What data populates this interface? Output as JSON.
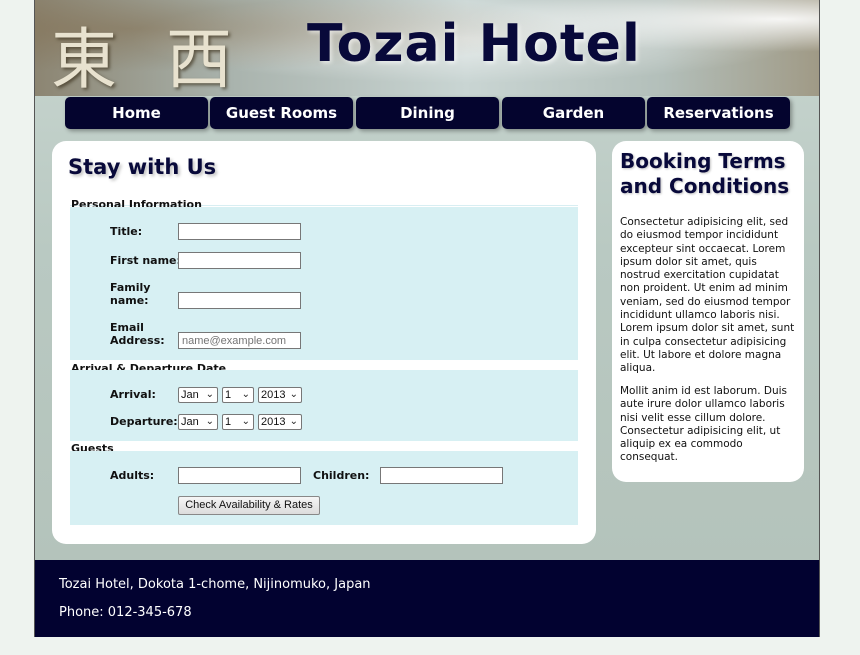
{
  "header": {
    "kanji": "東 西",
    "title": "Tozai Hotel"
  },
  "nav": {
    "items": [
      {
        "label": "Home"
      },
      {
        "label": "Guest Rooms"
      },
      {
        "label": "Dining"
      },
      {
        "label": "Garden"
      },
      {
        "label": "Reservations"
      }
    ]
  },
  "form": {
    "heading": "Stay with Us",
    "personal": {
      "legend": "Personal Information",
      "title_label": "Title:",
      "title_value": "",
      "first_name_label": "First name:",
      "first_name_value": "",
      "family_name_label": "Family name:",
      "family_name_value": "",
      "email_label": "Email Address:",
      "email_placeholder": "name@example.com"
    },
    "dates": {
      "legend": "Arrival & Departure Date",
      "arrival_label": "Arrival:",
      "arrival": {
        "month": "Jan",
        "day": "1",
        "year": "2013"
      },
      "departure_label": "Departure:",
      "departure": {
        "month": "Jan",
        "day": "1",
        "year": "2013"
      }
    },
    "guests": {
      "legend": "Guests",
      "adults_label": "Adults:",
      "adults_value": "",
      "children_label": "Children:",
      "children_value": ""
    },
    "submit_label": "Check Availability & Rates"
  },
  "sidebar": {
    "heading": "Booking Terms and Conditions",
    "paragraphs": [
      "Consectetur adipisicing elit, sed do eiusmod tempor incididunt excepteur sint occaecat. Lorem ipsum dolor sit amet, quis nostrud exercitation cupidatat non proident. Ut enim ad minim veniam, sed do eiusmod tempor incididunt ullamco laboris nisi. Lorem ipsum dolor sit amet, sunt in culpa consectetur adipisicing elit. Ut labore et dolore magna aliqua.",
      "Mollit anim id est laborum. Duis aute irure dolor ullamco laboris nisi velit esse cillum dolore. Consectetur adipisicing elit, ut aliquip ex ea commodo consequat."
    ]
  },
  "footer": {
    "address": "Tozai Hotel, Dokota 1-chome, Nijinomuko, Japan",
    "phone": "Phone: 012-345-678"
  },
  "colors": {
    "navy": "#04042e",
    "fieldset_bg": "#d7f0f3",
    "footer_bg": "#020230"
  },
  "icons": [
    "chevron-down-icon"
  ]
}
